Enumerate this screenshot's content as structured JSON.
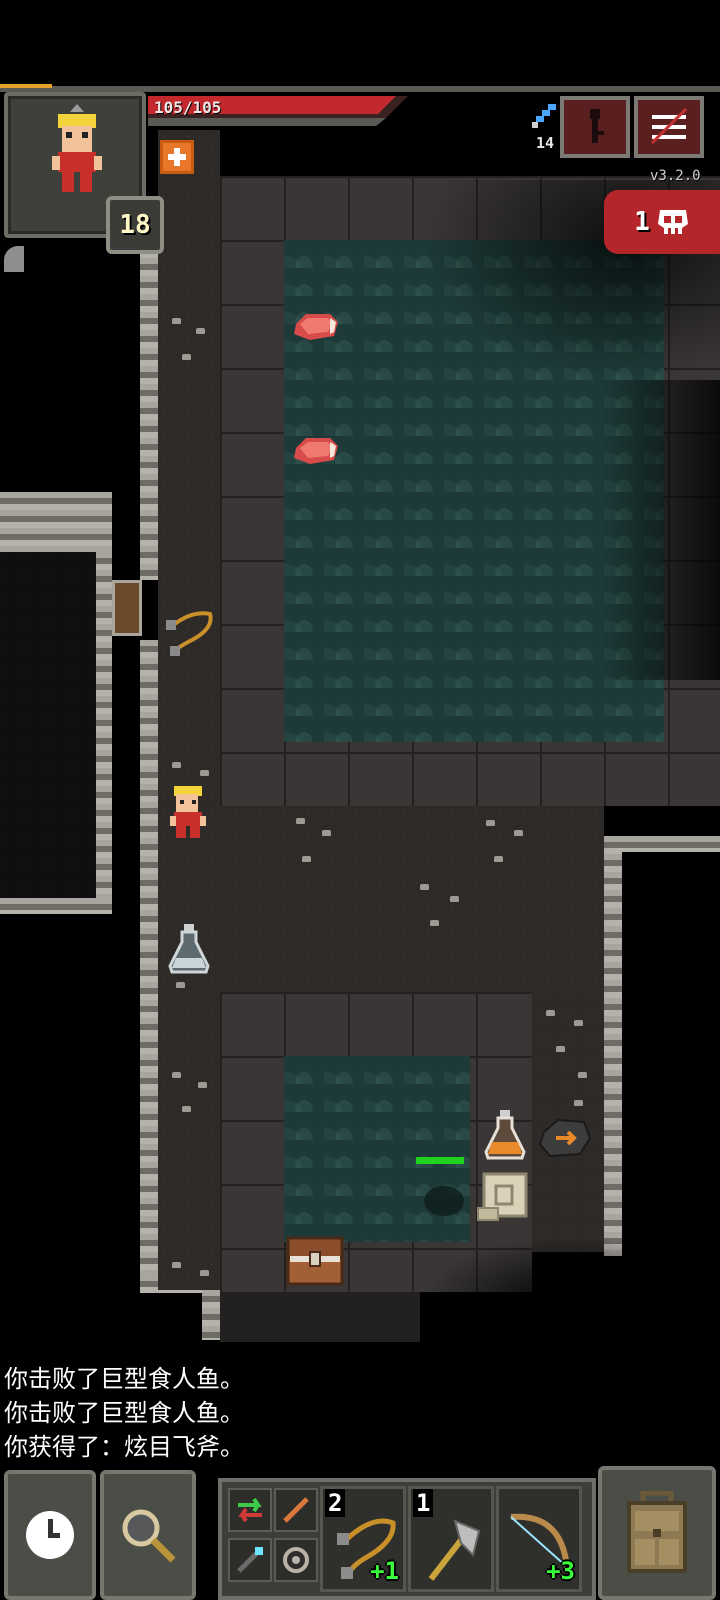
{
  "status": {
    "hp_text": "105/105",
    "level": "18",
    "depth": "14",
    "version": "v3.2.0",
    "danger_count": "1",
    "xp_fraction": 0.07,
    "hp_fraction": 1.0
  },
  "top_buttons": {
    "journal_icon": "journal-key-icon",
    "menu_icon": "menu-icon"
  },
  "map_items": [
    {
      "name": "raw-meat-1"
    },
    {
      "name": "raw-meat-2"
    },
    {
      "name": "chain-whip"
    },
    {
      "name": "potion-flask"
    },
    {
      "name": "orange-potion"
    },
    {
      "name": "runestone"
    },
    {
      "name": "scroll"
    },
    {
      "name": "treasure-chest"
    }
  ],
  "log": [
    "你击败了巨型食人鱼。",
    "你击败了巨型食人鱼。",
    "你获得了：炫目飞斧。"
  ],
  "toolbar": {
    "wait_icon": "clock-icon",
    "search_icon": "magnifier-icon",
    "inventory_icon": "backpack-icon"
  },
  "quickslots": [
    {
      "qty": "2",
      "upgrade": "+1",
      "item": "whip"
    },
    {
      "qty": "1",
      "upgrade": "",
      "item": "axe"
    },
    {
      "qty": "",
      "upgrade": "+3",
      "item": "bow"
    }
  ],
  "colors": {
    "hp_bar": "#c2282c",
    "danger": "#b5262b",
    "upgrade": "#3cff3c",
    "water": "#1d3a38"
  }
}
